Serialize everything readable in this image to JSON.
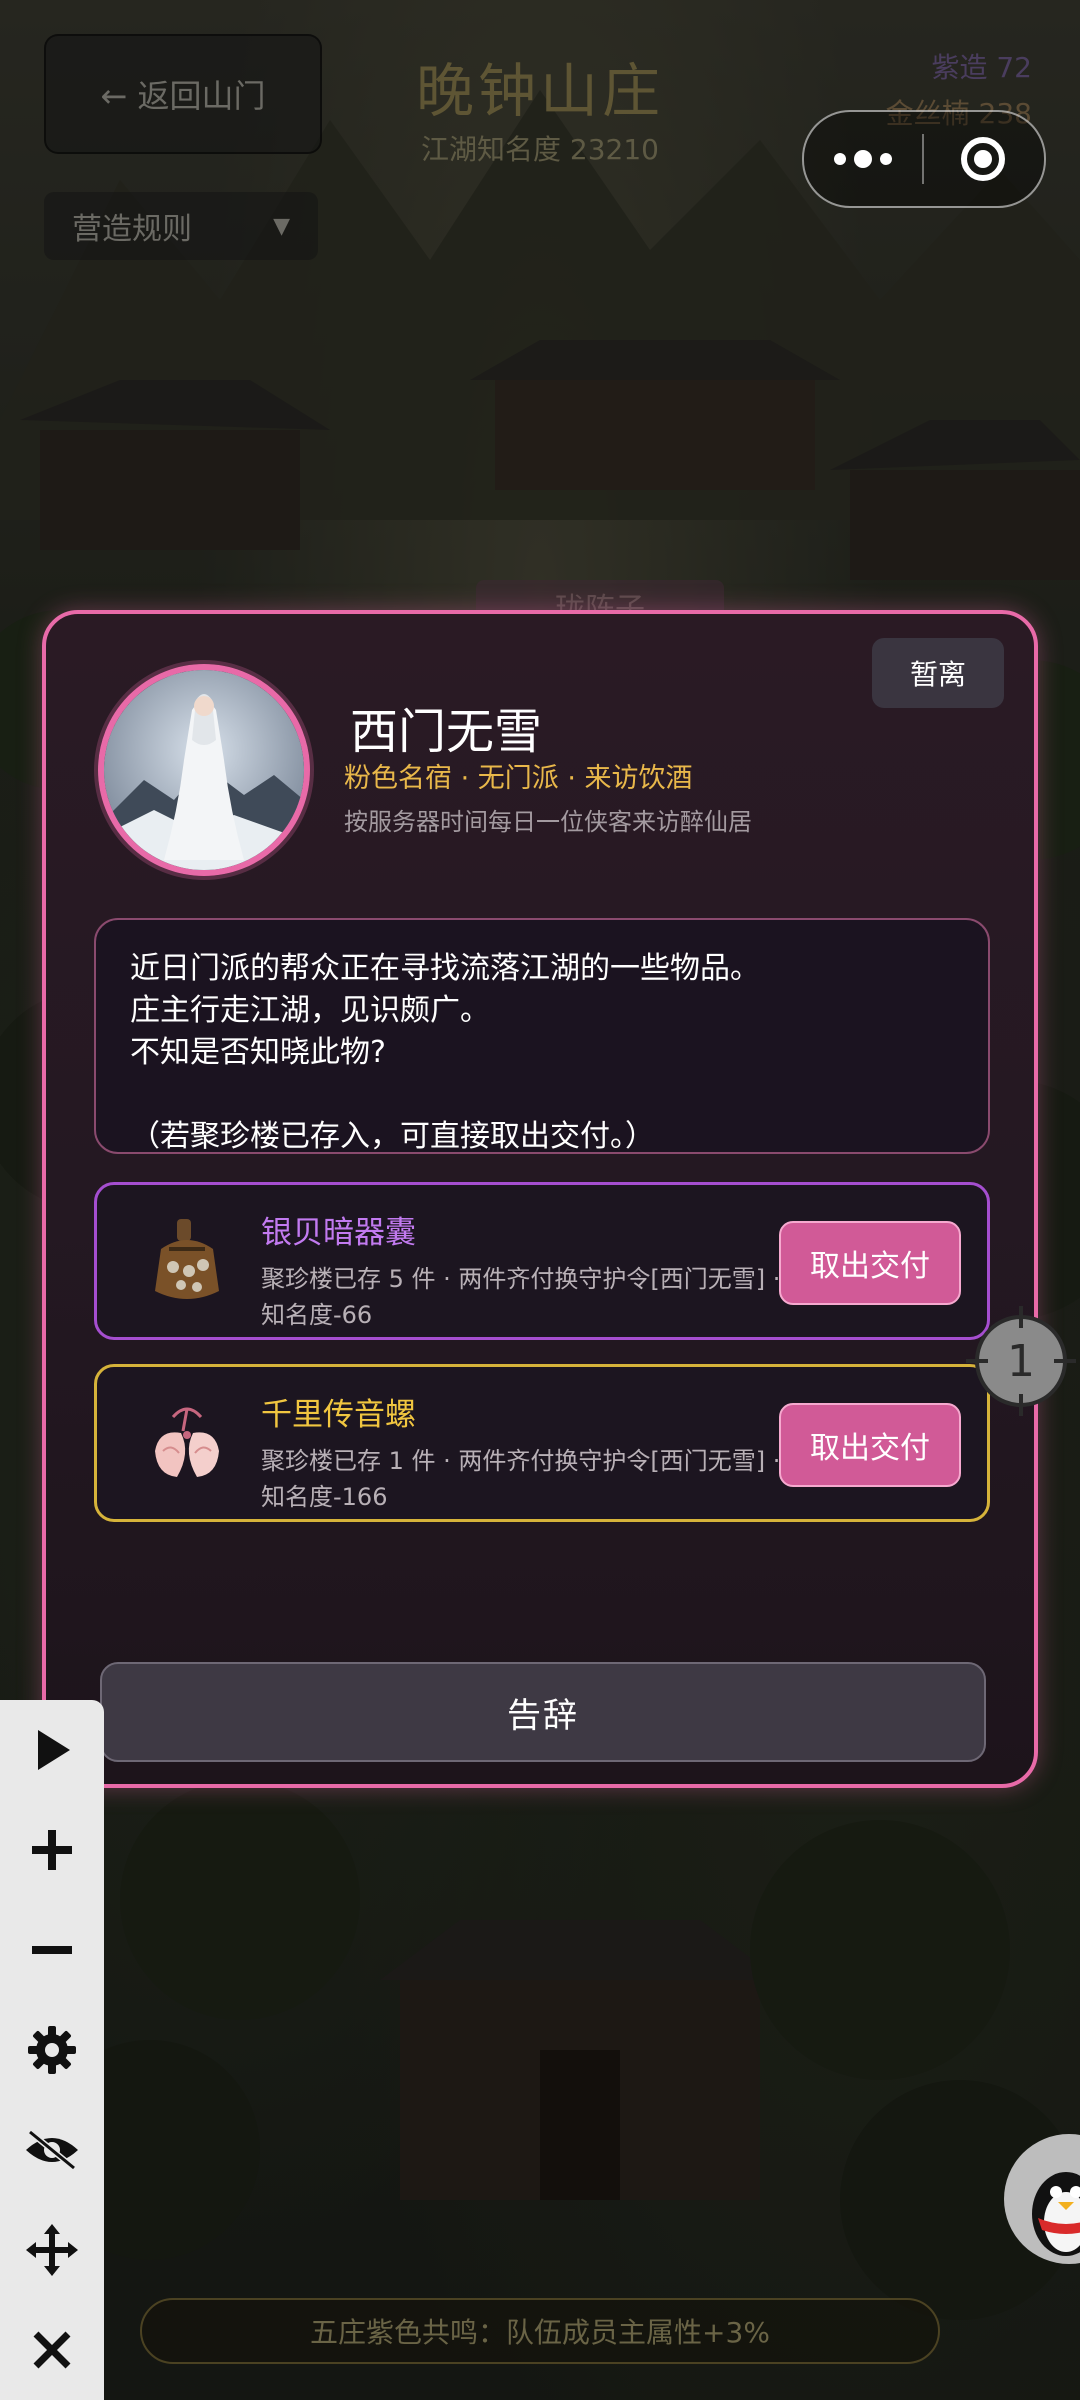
{
  "header": {
    "back_label": "← 返回山门",
    "rules_label": "营造规则",
    "manor_title": "晚钟山庄",
    "manor_subtitle": "江湖知名度 23210",
    "resource_1": "紫造 72",
    "resource_2": "金丝楠 238"
  },
  "background": {
    "partial_label": "珑阵子"
  },
  "modal": {
    "leave_label": "暂离",
    "visitor_name": "西门无雪",
    "visitor_tags": "粉色名宿 · 无门派 · 来访饮酒",
    "visitor_desc": "按服务器时间每日一位侠客来访醉仙居",
    "dialog_lines": [
      "近日门派的帮众正在寻找流落江湖的一些物品。",
      "庄主行走江湖，见识颇广。",
      "不知是否知晓此物?",
      "",
      "（若聚珍楼已存入，可直接取出交付。）"
    ],
    "items": [
      {
        "name": "银贝暗器囊",
        "info": "聚珍楼已存 5 件 · 两件齐付换守护令[西门无雪] · 知名度-66",
        "button": "取出交付",
        "rarity_color": "#a54ed0"
      },
      {
        "name": "千里传音螺",
        "info": "聚珍楼已存 1 件 · 两件齐付换守护令[西门无雪] · 知名度-166",
        "button": "取出交付",
        "rarity_color": "#d6b33a"
      }
    ],
    "farewell_label": "告辞",
    "accent_color": "#e86aa8"
  },
  "marker": {
    "number": "1"
  },
  "toolbar": {
    "icons": [
      "play-icon",
      "plus-icon",
      "minus-icon",
      "gear-icon",
      "eye-off-icon",
      "move-icon",
      "close-icon"
    ]
  },
  "footer": {
    "banner_text": "五庄紫色共鸣：队伍成员主属性+3%"
  }
}
